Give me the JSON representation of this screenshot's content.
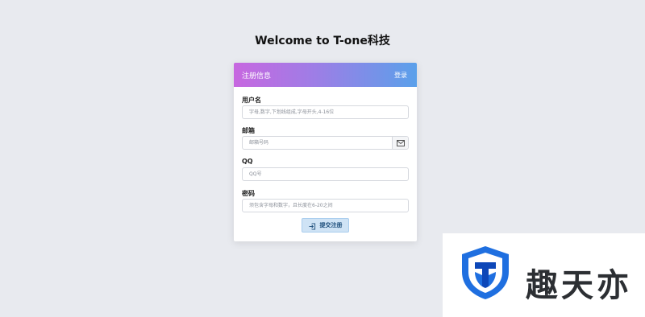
{
  "page": {
    "title": "Welcome to T-one科技"
  },
  "form": {
    "header_title": "注册信息",
    "login_link": "登录",
    "fields": [
      {
        "label": "用户名",
        "placeholder": "字母,数字,下划线组成,字母开头,4-16位"
      },
      {
        "label": "邮箱",
        "placeholder": "邮箱号码",
        "icon": "envelope-icon"
      },
      {
        "label": "QQ",
        "placeholder": "QQ号"
      },
      {
        "label": "密码",
        "placeholder": "须包含字母和数字，且长度在6-20之间"
      }
    ],
    "submit_label": "提交注册",
    "submit_icon": "sign-in-icon"
  },
  "watermark": {
    "text": "趣天亦",
    "logo": "shield-logo",
    "colors": {
      "logo_blue": "#1f6fe0",
      "logo_dark": "#0d47b8"
    }
  },
  "colors": {
    "background": "#e8eaef",
    "header_gradient_start": "#c767e0",
    "header_gradient_end": "#5aa0ea",
    "button_bg": "#cfe3f5"
  }
}
